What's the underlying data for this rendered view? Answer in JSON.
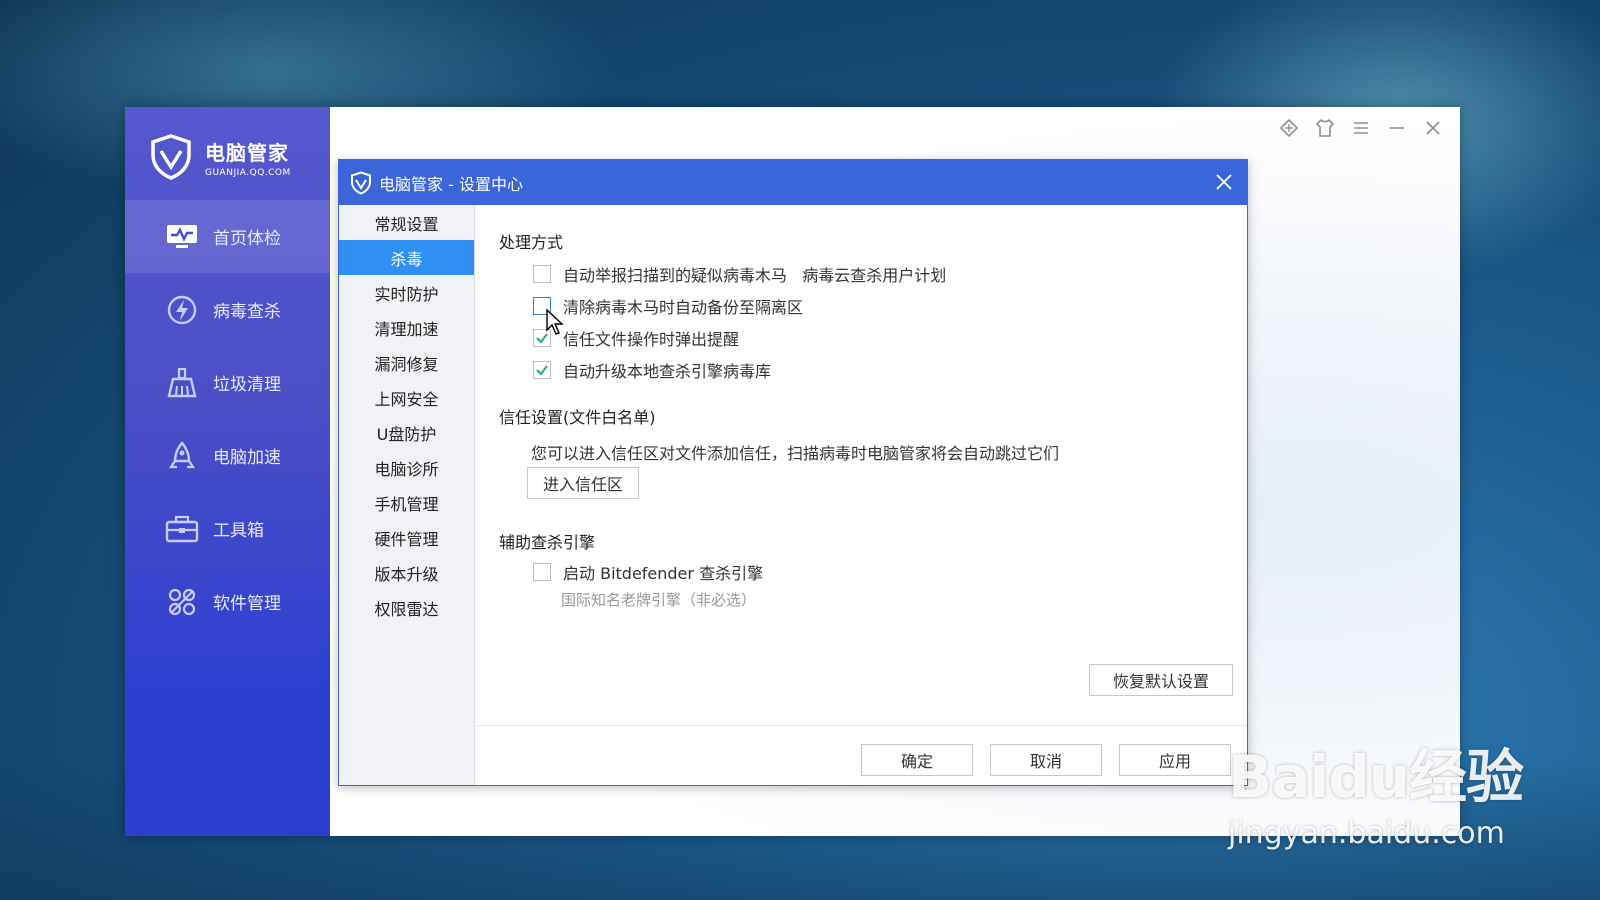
{
  "app": {
    "brand_name": "电脑管家",
    "brand_sub": "GUANJIA.QQ.COM",
    "nav": [
      {
        "label": "首页体检",
        "icon": "monitor-check-icon"
      },
      {
        "label": "病毒查杀",
        "icon": "lightning-icon"
      },
      {
        "label": "垃圾清理",
        "icon": "broom-icon"
      },
      {
        "label": "电脑加速",
        "icon": "rocket-icon"
      },
      {
        "label": "工具箱",
        "icon": "toolbox-icon"
      },
      {
        "label": "软件管理",
        "icon": "apps-icon"
      }
    ]
  },
  "dialog": {
    "title": "电脑管家 - 设置中心",
    "menu": [
      "常规设置",
      "杀毒",
      "实时防护",
      "清理加速",
      "漏洞修复",
      "上网安全",
      "U盘防护",
      "电脑诊所",
      "手机管理",
      "硬件管理",
      "版本升级",
      "权限雷达"
    ],
    "active_menu": "杀毒",
    "section1": {
      "title": "处理方式",
      "options": [
        {
          "label": "自动举报扫描到的疑似病毒木马   病毒云查杀用户计划",
          "checked": false
        },
        {
          "label": "清除病毒木马时自动备份至隔离区",
          "checked": false
        },
        {
          "label": "信任文件操作时弹出提醒",
          "checked": true
        },
        {
          "label": "自动升级本地查杀引擎病毒库",
          "checked": true
        }
      ]
    },
    "section2": {
      "title": "信任设置(文件白名单)",
      "desc": "您可以进入信任区对文件添加信任，扫描病毒时电脑管家将会自动跳过它们",
      "button": "进入信任区"
    },
    "section3": {
      "title": "辅助查杀引擎",
      "option": {
        "label": "启动 Bitdefender 查杀引擎",
        "checked": false
      },
      "subdesc": "国际知名老牌引擎（非必选）"
    },
    "restore_button": "恢复默认设置",
    "ok_button": "确定",
    "cancel_button": "取消",
    "apply_button": "应用"
  },
  "watermark": {
    "logo": "Baidu经验",
    "url": "jingyan.baidu.com"
  },
  "colors": {
    "sidebar": "#4a4fc6",
    "dialog_title": "#3a66da",
    "menu_active": "#2f8ff2",
    "check": "#2fb36c"
  }
}
